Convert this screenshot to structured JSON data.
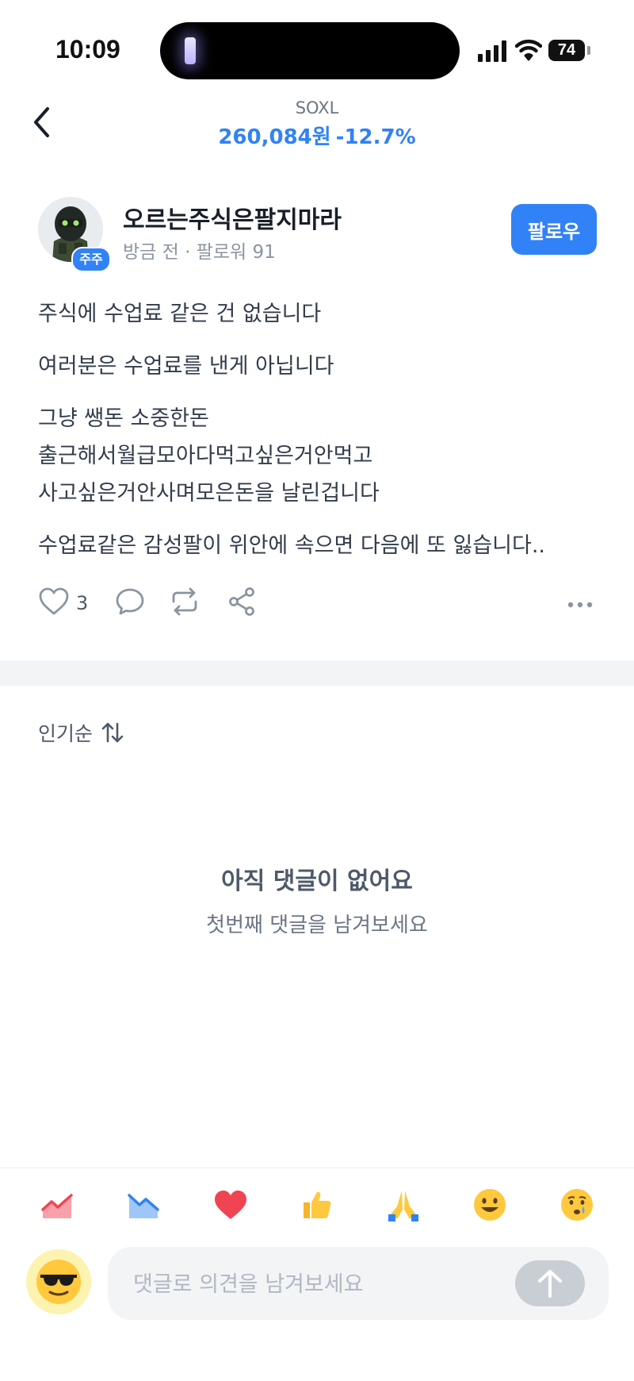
{
  "status_bar": {
    "time": "10:09",
    "battery": "74"
  },
  "header": {
    "ticker": "SOXL",
    "price": "260,084원",
    "change": "-12.7%"
  },
  "author": {
    "badge": "주주",
    "name": "오르는주식은팔지마라",
    "meta": "방금 전 · 팔로워 91",
    "follow_label": "팔로우"
  },
  "post": {
    "paragraphs": [
      "주식에 수업료 같은 건 없습니다",
      "여러분은 수업료를 낸게 아닙니다",
      "그냥 쌩돈 소중한돈\n출근해서월급모아다먹고싶은거안먹고\n사고싶은거안사며모은돈을 날린겁니다",
      "수업료같은 감성팔이 위안에 속으면 다음에 또 잃습니다.."
    ]
  },
  "actions": {
    "like_count": "3"
  },
  "comments": {
    "sort_label": "인기순",
    "empty_title": "아직 댓글이 없어요",
    "empty_subtitle": "첫번째 댓글을 남겨보세요"
  },
  "reactions": [
    "chart-up-icon",
    "chart-down-icon",
    "heart-icon",
    "thumbs-up-icon",
    "pray-icon",
    "smile-icon",
    "crying-icon"
  ],
  "composer": {
    "placeholder": "댓글로 의견을 남겨보세요"
  },
  "colors": {
    "accent": "#3182f6",
    "text": "#333d4b",
    "muted": "#8b95a1",
    "divider": "#f2f4f6"
  }
}
